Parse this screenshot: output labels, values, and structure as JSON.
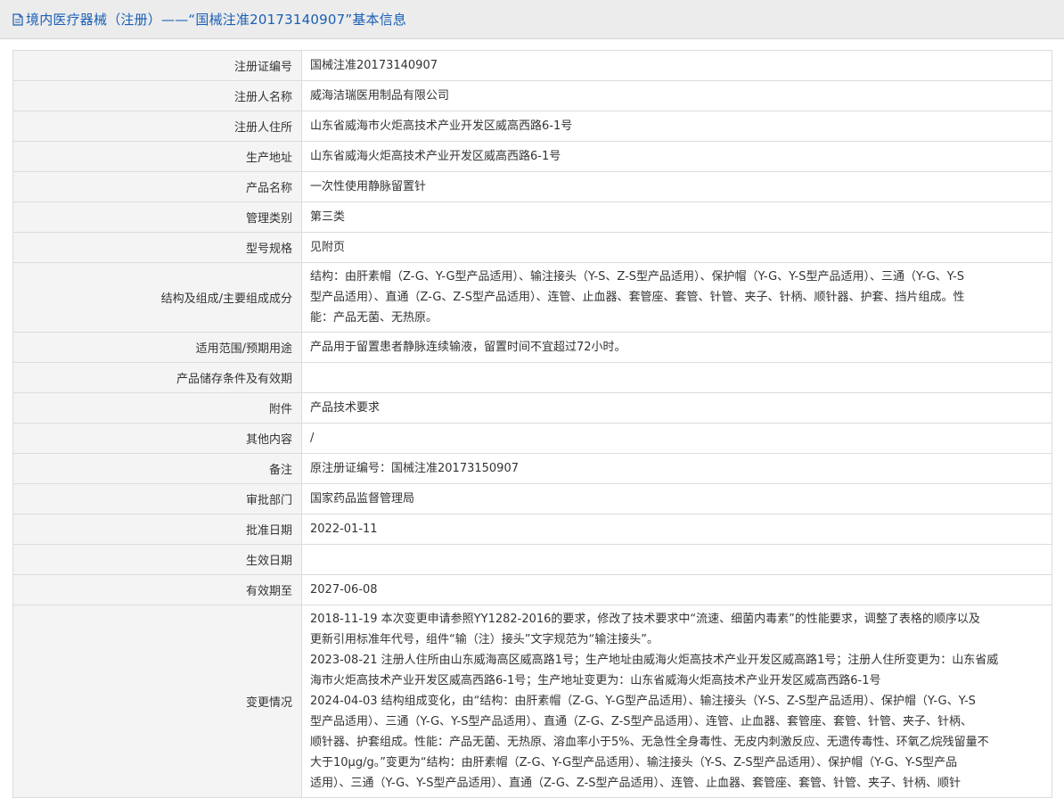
{
  "header": {
    "title": "境内医疗器械（注册）——“国械注准20173140907”基本信息"
  },
  "rows": [
    {
      "label": "注册证编号",
      "value": "国械注准20173140907"
    },
    {
      "label": "注册人名称",
      "value": "威海洁瑞医用制品有限公司"
    },
    {
      "label": "注册人住所",
      "value": "山东省威海市火炬高技术产业开发区威高西路6-1号"
    },
    {
      "label": "生产地址",
      "value": "山东省威海火炬高技术产业开发区威高西路6-1号"
    },
    {
      "label": "产品名称",
      "value": "一次性使用静脉留置针"
    },
    {
      "label": "管理类别",
      "value": "第三类"
    },
    {
      "label": "型号规格",
      "value": "见附页"
    },
    {
      "label": "结构及组成/主要组成成分",
      "lines": [
        "结构：由肝素帽（Z-G、Y-G型产品适用）、输注接头（Y-S、Z-S型产品适用）、保护帽（Y-G、Y-S型产品适用）、三通（Y-G、Y-S",
        "型产品适用）、直通（Z-G、Z-S型产品适用）、连管、止血器、套管座、套管、针管、夹子、针柄、顺针器、护套、挡片组成。性",
        "能：产品无菌、无热原。"
      ]
    },
    {
      "label": "适用范围/预期用途",
      "value": "产品用于留置患者静脉连续输液，留置时间不宜超过72小时。"
    },
    {
      "label": "产品储存条件及有效期",
      "value": ""
    },
    {
      "label": "附件",
      "value": "产品技术要求"
    },
    {
      "label": "其他内容",
      "value": "/"
    },
    {
      "label": "备注",
      "value": "原注册证编号：国械注准20173150907"
    },
    {
      "label": "审批部门",
      "value": "国家药品监督管理局"
    },
    {
      "label": "批准日期",
      "value": "2022-01-11"
    },
    {
      "label": "生效日期",
      "value": ""
    },
    {
      "label": "有效期至",
      "value": "2027-06-08"
    },
    {
      "label": "变更情况",
      "lines": [
        "2018-11-19 本次变更申请参照YY1282-2016的要求，修改了技术要求中“流速、细菌内毒素”的性能要求，调整了表格的顺序以及",
        "更新引用标准年代号，组件“输（注）接头”文字规范为“输注接头”。",
        "2023-08-21 注册人住所由山东威海高区威高路1号；生产地址由威海火炬高技术产业开发区威高路1号；注册人住所变更为：山东省威",
        "海市火炬高技术产业开发区威高西路6-1号；生产地址变更为：山东省威海火炬高技术产业开发区威高西路6-1号",
        "2024-04-03 结构组成变化，由“结构：由肝素帽（Z-G、Y-G型产品适用）、输注接头（Y-S、Z-S型产品适用）、保护帽（Y-G、Y-S",
        "型产品适用）、三通（Y-G、Y-S型产品适用）、直通（Z-G、Z-S型产品适用）、连管、止血器、套管座、套管、针管、夹子、针柄、",
        "顺针器、护套组成。性能：产品无菌、无热原、溶血率小于5%、无急性全身毒性、无皮内刺激反应、无遗传毒性、环氧乙烷残留量不",
        "大于10μg/g。”变更为“结构：由肝素帽（Z-G、Y-G型产品适用）、输注接头（Y-S、Z-S型产品适用）、保护帽（Y-G、Y-S型产品",
        "适用）、三通（Y-G、Y-S型产品适用）、直通（Z-G、Z-S型产品适用）、连管、止血器、套管座、套管、针管、夹子、针柄、顺针"
      ]
    }
  ]
}
